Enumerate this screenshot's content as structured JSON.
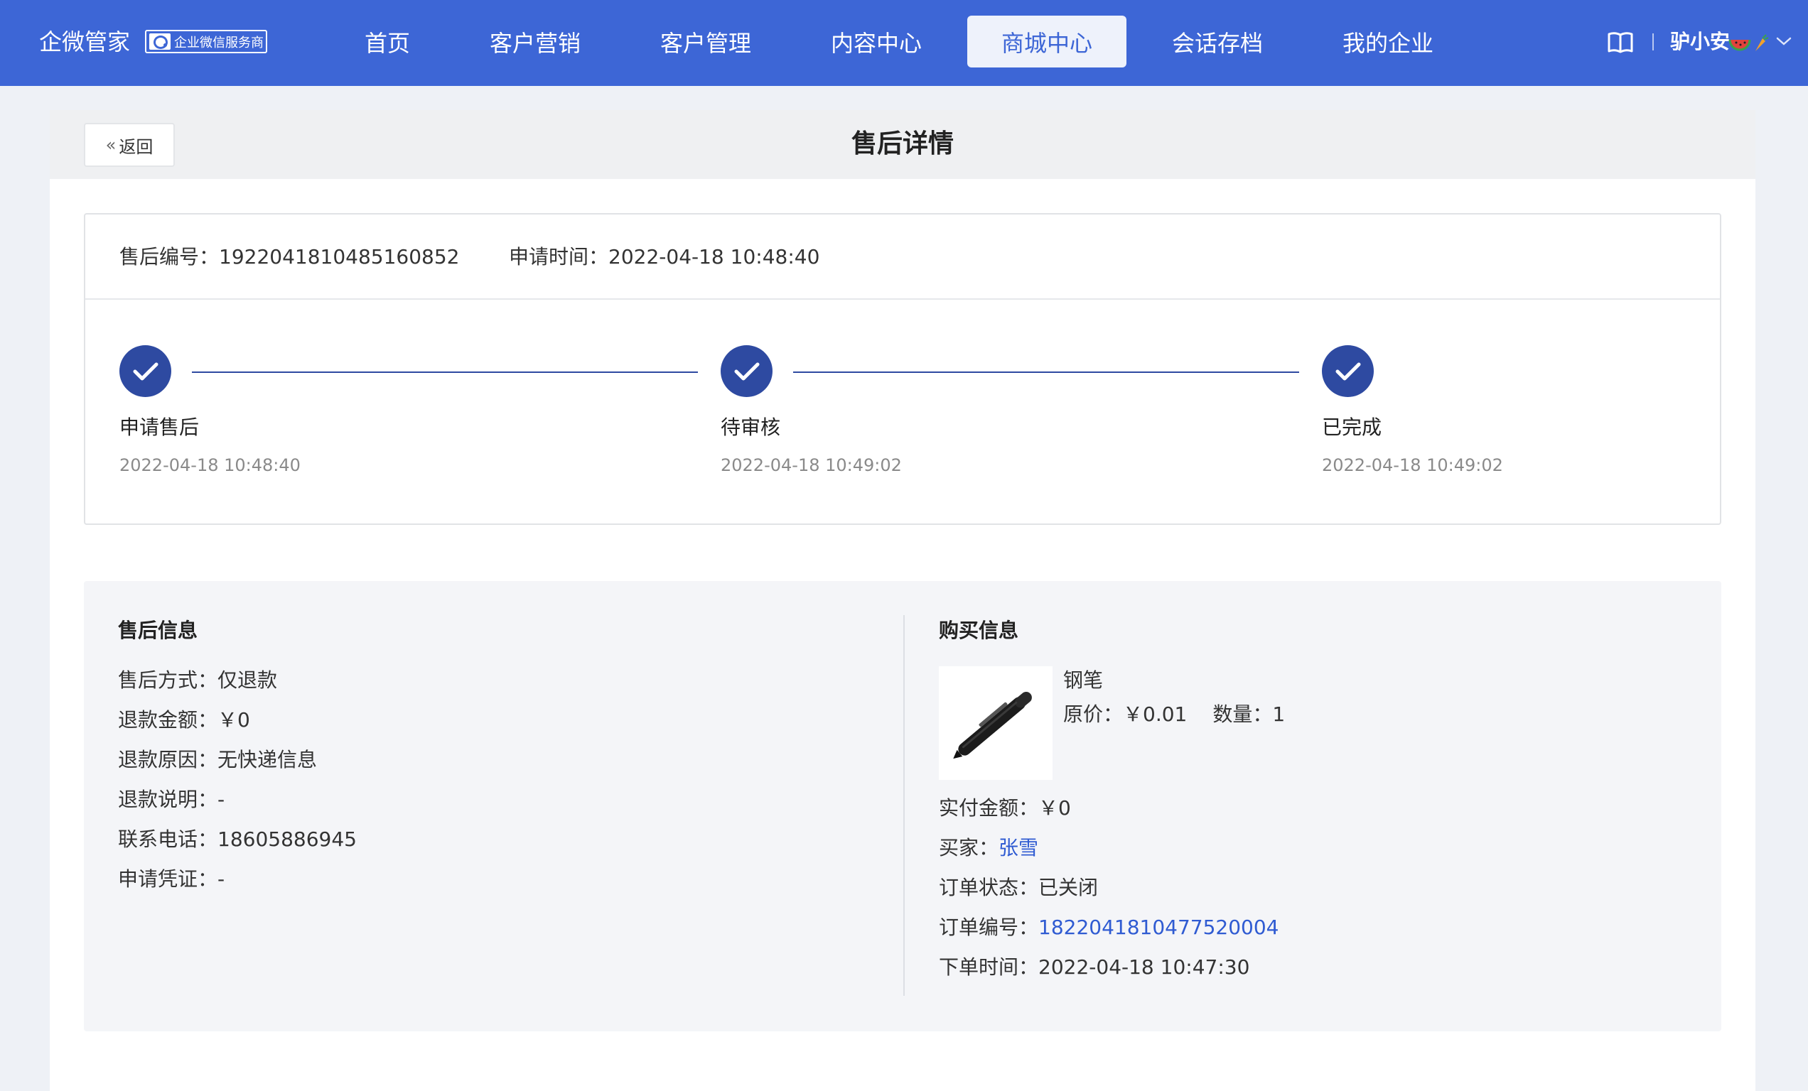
{
  "topnav": {
    "brand": "企微管家",
    "badge": "企业微信服务商",
    "items": [
      {
        "label": "首页",
        "active": false
      },
      {
        "label": "客户营销",
        "active": false
      },
      {
        "label": "客户管理",
        "active": false
      },
      {
        "label": "内容中心",
        "active": false
      },
      {
        "label": "商城中心",
        "active": true
      },
      {
        "label": "会话存档",
        "active": false
      },
      {
        "label": "我的企业",
        "active": false
      }
    ],
    "user_name": "驴小安",
    "accent_color": "#3d66d6"
  },
  "page": {
    "back_label": "返回",
    "title": "售后详情"
  },
  "order_meta": {
    "aftersale_no_label": "售后编号：",
    "aftersale_no": "1922041810485160852",
    "apply_time_label": "申请时间：",
    "apply_time": "2022-04-18 10:48:40"
  },
  "steps": [
    {
      "title": "申请售后",
      "time": "2022-04-18 10:48:40",
      "done": true
    },
    {
      "title": "待审核",
      "time": "2022-04-18 10:49:02",
      "done": true
    },
    {
      "title": "已完成",
      "time": "2022-04-18 10:49:02",
      "done": true
    }
  ],
  "aftersale_info": {
    "title": "售后信息",
    "rows": [
      {
        "label": "售后方式：",
        "value": "仅退款"
      },
      {
        "label": "退款金额：",
        "value": "￥0"
      },
      {
        "label": "退款原因：",
        "value": "无快递信息"
      },
      {
        "label": "退款说明：",
        "value": "-"
      },
      {
        "label": "联系电话：",
        "value": "18605886945"
      },
      {
        "label": "申请凭证：",
        "value": "-"
      }
    ]
  },
  "purchase_info": {
    "title": "购买信息",
    "product_name": "钢笔",
    "price_label": "原价：",
    "price": "￥0.01",
    "qty_label": "数量：",
    "qty": "1",
    "paid_label": "实付金额：",
    "paid": "￥0",
    "buyer_label": "买家：",
    "buyer": "张雪",
    "status_label": "订单状态：",
    "status": "已关闭",
    "order_no_label": "订单编号：",
    "order_no": "1822041810477520004",
    "order_time_label": "下单时间：",
    "order_time": "2022-04-18 10:47:30"
  }
}
